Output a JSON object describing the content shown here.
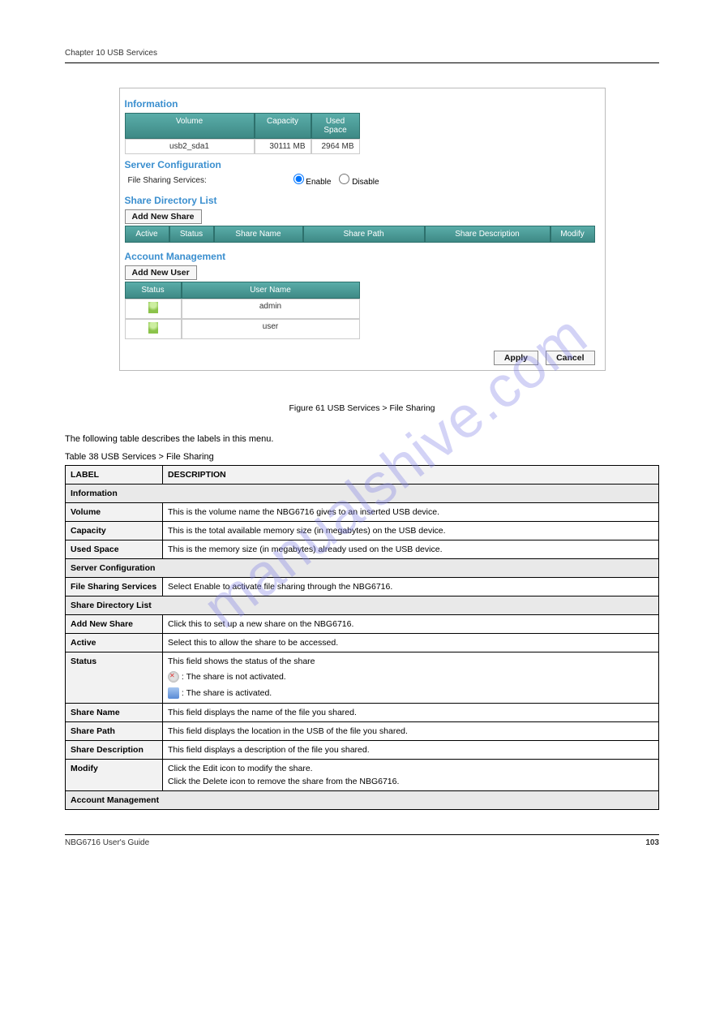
{
  "header_line": "Chapter 10 USB Services",
  "panel": {
    "info_title": "Information",
    "info_headers": {
      "vol": "Volume",
      "cap": "Capacity",
      "used": "Used Space"
    },
    "info_row": {
      "vol": "usb2_sda1",
      "cap": "30111 MB",
      "used": "2964 MB"
    },
    "srvcfg_title": "Server Configuration",
    "fs_label": "File Sharing Services:",
    "enable": "Enable",
    "disable": "Disable",
    "sharelist_title": "Share Directory List",
    "add_share_btn": "Add New Share",
    "share_headers": {
      "active": "Active",
      "status": "Status",
      "name": "Share Name",
      "path": "Share Path",
      "desc": "Share Description",
      "modify": "Modify"
    },
    "acct_title": "Account Management",
    "add_user_btn": "Add New User",
    "acct_headers": {
      "status": "Status",
      "user": "User Name"
    },
    "acct_rows": [
      {
        "user": "admin"
      },
      {
        "user": "user"
      }
    ],
    "apply": "Apply",
    "cancel": "Cancel"
  },
  "figure_caption": "Figure 61   USB Services > File Sharing",
  "desc_before_table": "The following table describes the labels in this menu.",
  "table_caption": "Table 38   USB Services > File Sharing",
  "table": {
    "th_label": "LABEL",
    "th_desc": "DESCRIPTION",
    "grp_info": "Information",
    "r_volume_l": "Volume",
    "r_volume_d": "This is the volume name the NBG6716 gives to an inserted USB device.",
    "r_cap_l": "Capacity",
    "r_cap_d": "This is the total available memory size (in megabytes) on the USB device.",
    "r_used_l": "Used Space",
    "r_used_d": "This is the memory size (in megabytes) already used on the USB device.",
    "grp_srv": "Server Configuration",
    "r_fs_l": "File Sharing Services",
    "r_fs_d": "Select Enable to activate file sharing through the NBG6716.",
    "grp_share": "Share Directory List",
    "r_add_l": "Add New Share",
    "r_add_d": "Click this to set up a new share on the NBG6716.",
    "r_active_l": "Active",
    "r_active_d": "Select this to allow the share to be accessed.",
    "r_status_l": "Status",
    "r_status_d1": "This field shows the status of the share",
    "r_status_d2": ": The share is not activated.",
    "r_status_d3": ": The share is activated.",
    "r_sn_l": "Share Name",
    "r_sn_d": "This field displays the name of the file you shared.",
    "r_sp_l": "Share Path",
    "r_sp_d": "This field displays the location in the USB of the file you shared.",
    "r_sd_l": "Share Description",
    "r_sd_d": "This field displays a description of the file you shared.",
    "r_mod_l": "Modify",
    "r_mod_d1": "Click the Edit icon to modify the share.",
    "r_mod_d2": "Click the Delete icon to remove the share from the NBG6716.",
    "grp_acct": "Account Management"
  },
  "footer": {
    "left": "NBG6716 User's Guide",
    "right": "103"
  },
  "watermark": "manualshive.com"
}
